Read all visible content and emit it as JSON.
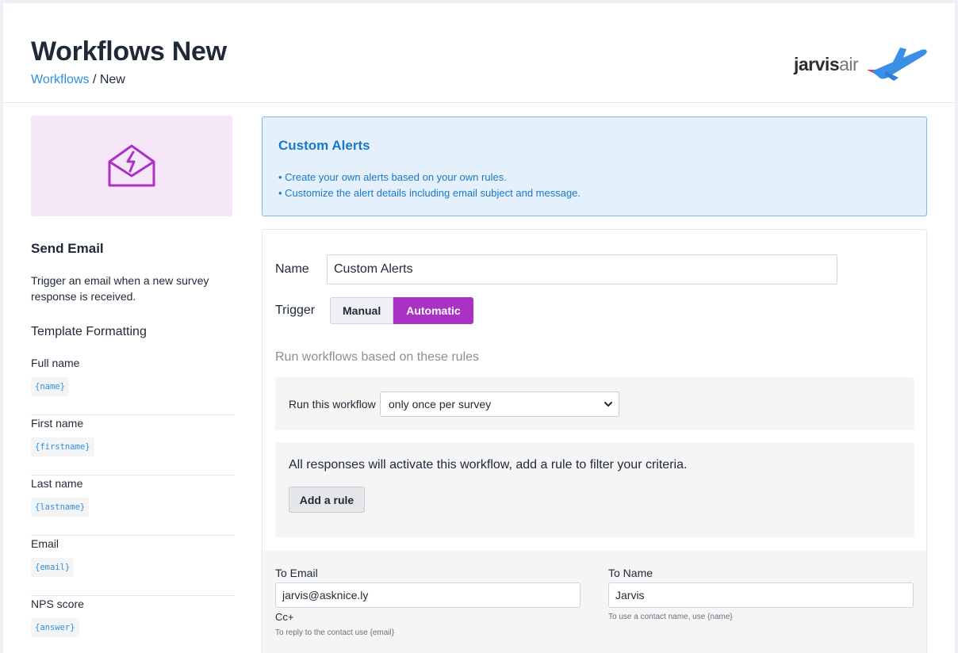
{
  "header": {
    "title": "Workflows New",
    "breadcrumb": {
      "link": "Workflows",
      "separator": " / ",
      "current": "New"
    },
    "logo": {
      "brand": "jarvis",
      "suffix": "air"
    }
  },
  "sidebar": {
    "icon": "email-bolt-icon",
    "title": "Send Email",
    "description": "Trigger an email when a new survey response is received.",
    "template_heading": "Template Formatting",
    "templates": [
      {
        "label": "Full name",
        "code": "{name}"
      },
      {
        "label": "First name",
        "code": "{firstname}"
      },
      {
        "label": "Last name",
        "code": "{lastname}"
      },
      {
        "label": "Email",
        "code": "{email}"
      },
      {
        "label": "NPS score",
        "code": "{answer}"
      }
    ]
  },
  "info": {
    "title": "Custom Alerts",
    "lines": [
      "• Create your own alerts based on your own rules.",
      "• Customize the alert details including email subject and message."
    ]
  },
  "form": {
    "name_label": "Name",
    "name_value": "Custom Alerts",
    "trigger_label": "Trigger",
    "trigger_options": [
      "Manual",
      "Automatic"
    ],
    "trigger_selected": "Automatic",
    "rules_hint": "Run workflows based on these rules",
    "run_label": "Run this workflow",
    "run_selected": "only once per survey",
    "rule_text": "All responses will activate this workflow, add a rule to filter your criteria.",
    "add_rule_label": "Add a rule",
    "to_email_label": "To Email",
    "to_email_value": "jarvis@asknice.ly",
    "cc_label": "Cc+",
    "cc_hint": "To reply to the contact use {email}",
    "to_name_label": "To Name",
    "to_name_value": "Jarvis",
    "to_name_hint": "To use a contact name, use {name}"
  },
  "colors": {
    "accent": "#a932c4",
    "link": "#2b8fe0",
    "info_bg": "#e4f1fc",
    "info_text": "#1a78c9",
    "hero_bg": "#f5e6f8"
  }
}
